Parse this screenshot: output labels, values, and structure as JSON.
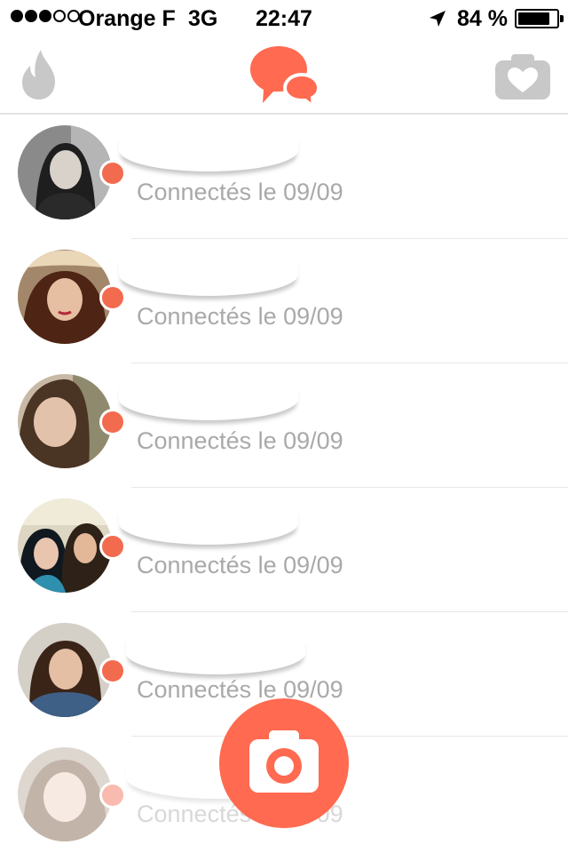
{
  "status_bar": {
    "carrier": "Orange F",
    "network": "3G",
    "time": "22:47",
    "battery_percent": "84 %",
    "battery_level": 0.84,
    "signal_bars": 3,
    "signal_total": 5
  },
  "nav": {
    "left_icon": "flame-icon",
    "center_icon": "chat-bubbles-icon",
    "right_icon": "camera-heart-icon"
  },
  "colors": {
    "accent": "#ff6a50",
    "badge": "#f26b4f",
    "inactive_icon": "#c8c8c8",
    "subtitle_text": "#a9a9a9",
    "separator": "#e7e7e7"
  },
  "matches": [
    {
      "subtitle": "Connectés le 09/09",
      "online": true
    },
    {
      "subtitle": "Connectés le 09/09",
      "online": true
    },
    {
      "subtitle": "Connectés le 09/09",
      "online": true
    },
    {
      "subtitle": "Connectés le 09/09",
      "online": true
    },
    {
      "subtitle": "Connectés le 09/09",
      "online": true
    },
    {
      "subtitle": "Connectés le 09/09",
      "online": true
    }
  ],
  "fab": {
    "icon": "camera-icon"
  }
}
